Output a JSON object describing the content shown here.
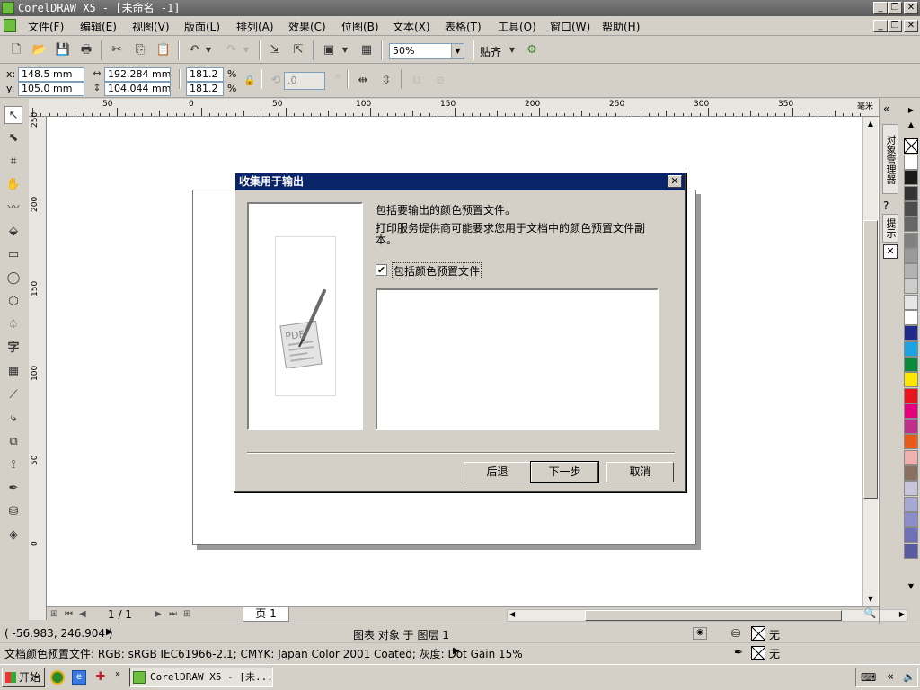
{
  "window": {
    "title": "CorelDRAW X5 - [未命名 -1]"
  },
  "menu": [
    "文件(F)",
    "编辑(E)",
    "视图(V)",
    "版面(L)",
    "排列(A)",
    "效果(C)",
    "位图(B)",
    "文本(X)",
    "表格(T)",
    "工具(O)",
    "窗口(W)",
    "帮助(H)"
  ],
  "toolbar": {
    "zoom": "50%",
    "snap_label": "贴齐"
  },
  "propbar": {
    "x_label": "x:",
    "x": "148.5 mm",
    "y_label": "y:",
    "y": "105.0 mm",
    "width": "192.284 mm",
    "height": "104.044 mm",
    "scale_x": "181.2",
    "scale_y": "181.2",
    "percent": "%",
    "angle": ".0"
  },
  "ruler": {
    "h_labels": [
      "50",
      "0",
      "50",
      "100",
      "150",
      "200",
      "250",
      "300",
      "350"
    ],
    "h_unit": "毫米",
    "v_labels": [
      "250",
      "200",
      "150",
      "100",
      "50",
      "0"
    ]
  },
  "pager": {
    "count": "1 / 1",
    "tab": "页 1"
  },
  "docker": {
    "tab1": "对象管理器",
    "tab2": "提示"
  },
  "palette": [
    "#ffffff",
    "#1a1a1a",
    "#333333",
    "#4d4d4d",
    "#666666",
    "#808080",
    "#999999",
    "#b3b3b3",
    "#cccccc",
    "#e6e6e6",
    "#ffffff",
    "#1f2a8a",
    "#1aa3e0",
    "#0b8a3c",
    "#ffe600",
    "#e8141e",
    "#e5007e",
    "#c02f8a",
    "#e85a1a",
    "#f0b0b0",
    "#8a7060",
    "#c8c4dc",
    "#a8a8d4",
    "#8c8ccc",
    "#7070b8",
    "#5a5aa0"
  ],
  "status": {
    "coords": "( -56.983, 246.904 )",
    "layer": "图表 对象 于 图层 1",
    "profile": "文档颜色预置文件: RGB: sRGB IEC61966-2.1; CMYK: Japan Color 2001 Coated; 灰度: Dot Gain 15%",
    "fill": "无",
    "outline": "无"
  },
  "taskbar": {
    "start": "开始",
    "item": "CorelDRAW X5 - [未..."
  },
  "dialog": {
    "title": "收集用于输出",
    "heading": "包括要输出的颜色预置文件。",
    "description": "打印服务提供商可能要求您用于文档中的颜色预置文件副本。",
    "checkbox_label": "包括颜色预置文件",
    "checkbox_checked": true,
    "back": "后退",
    "next": "下一步",
    "cancel": "取消",
    "image_text": "PDF"
  }
}
